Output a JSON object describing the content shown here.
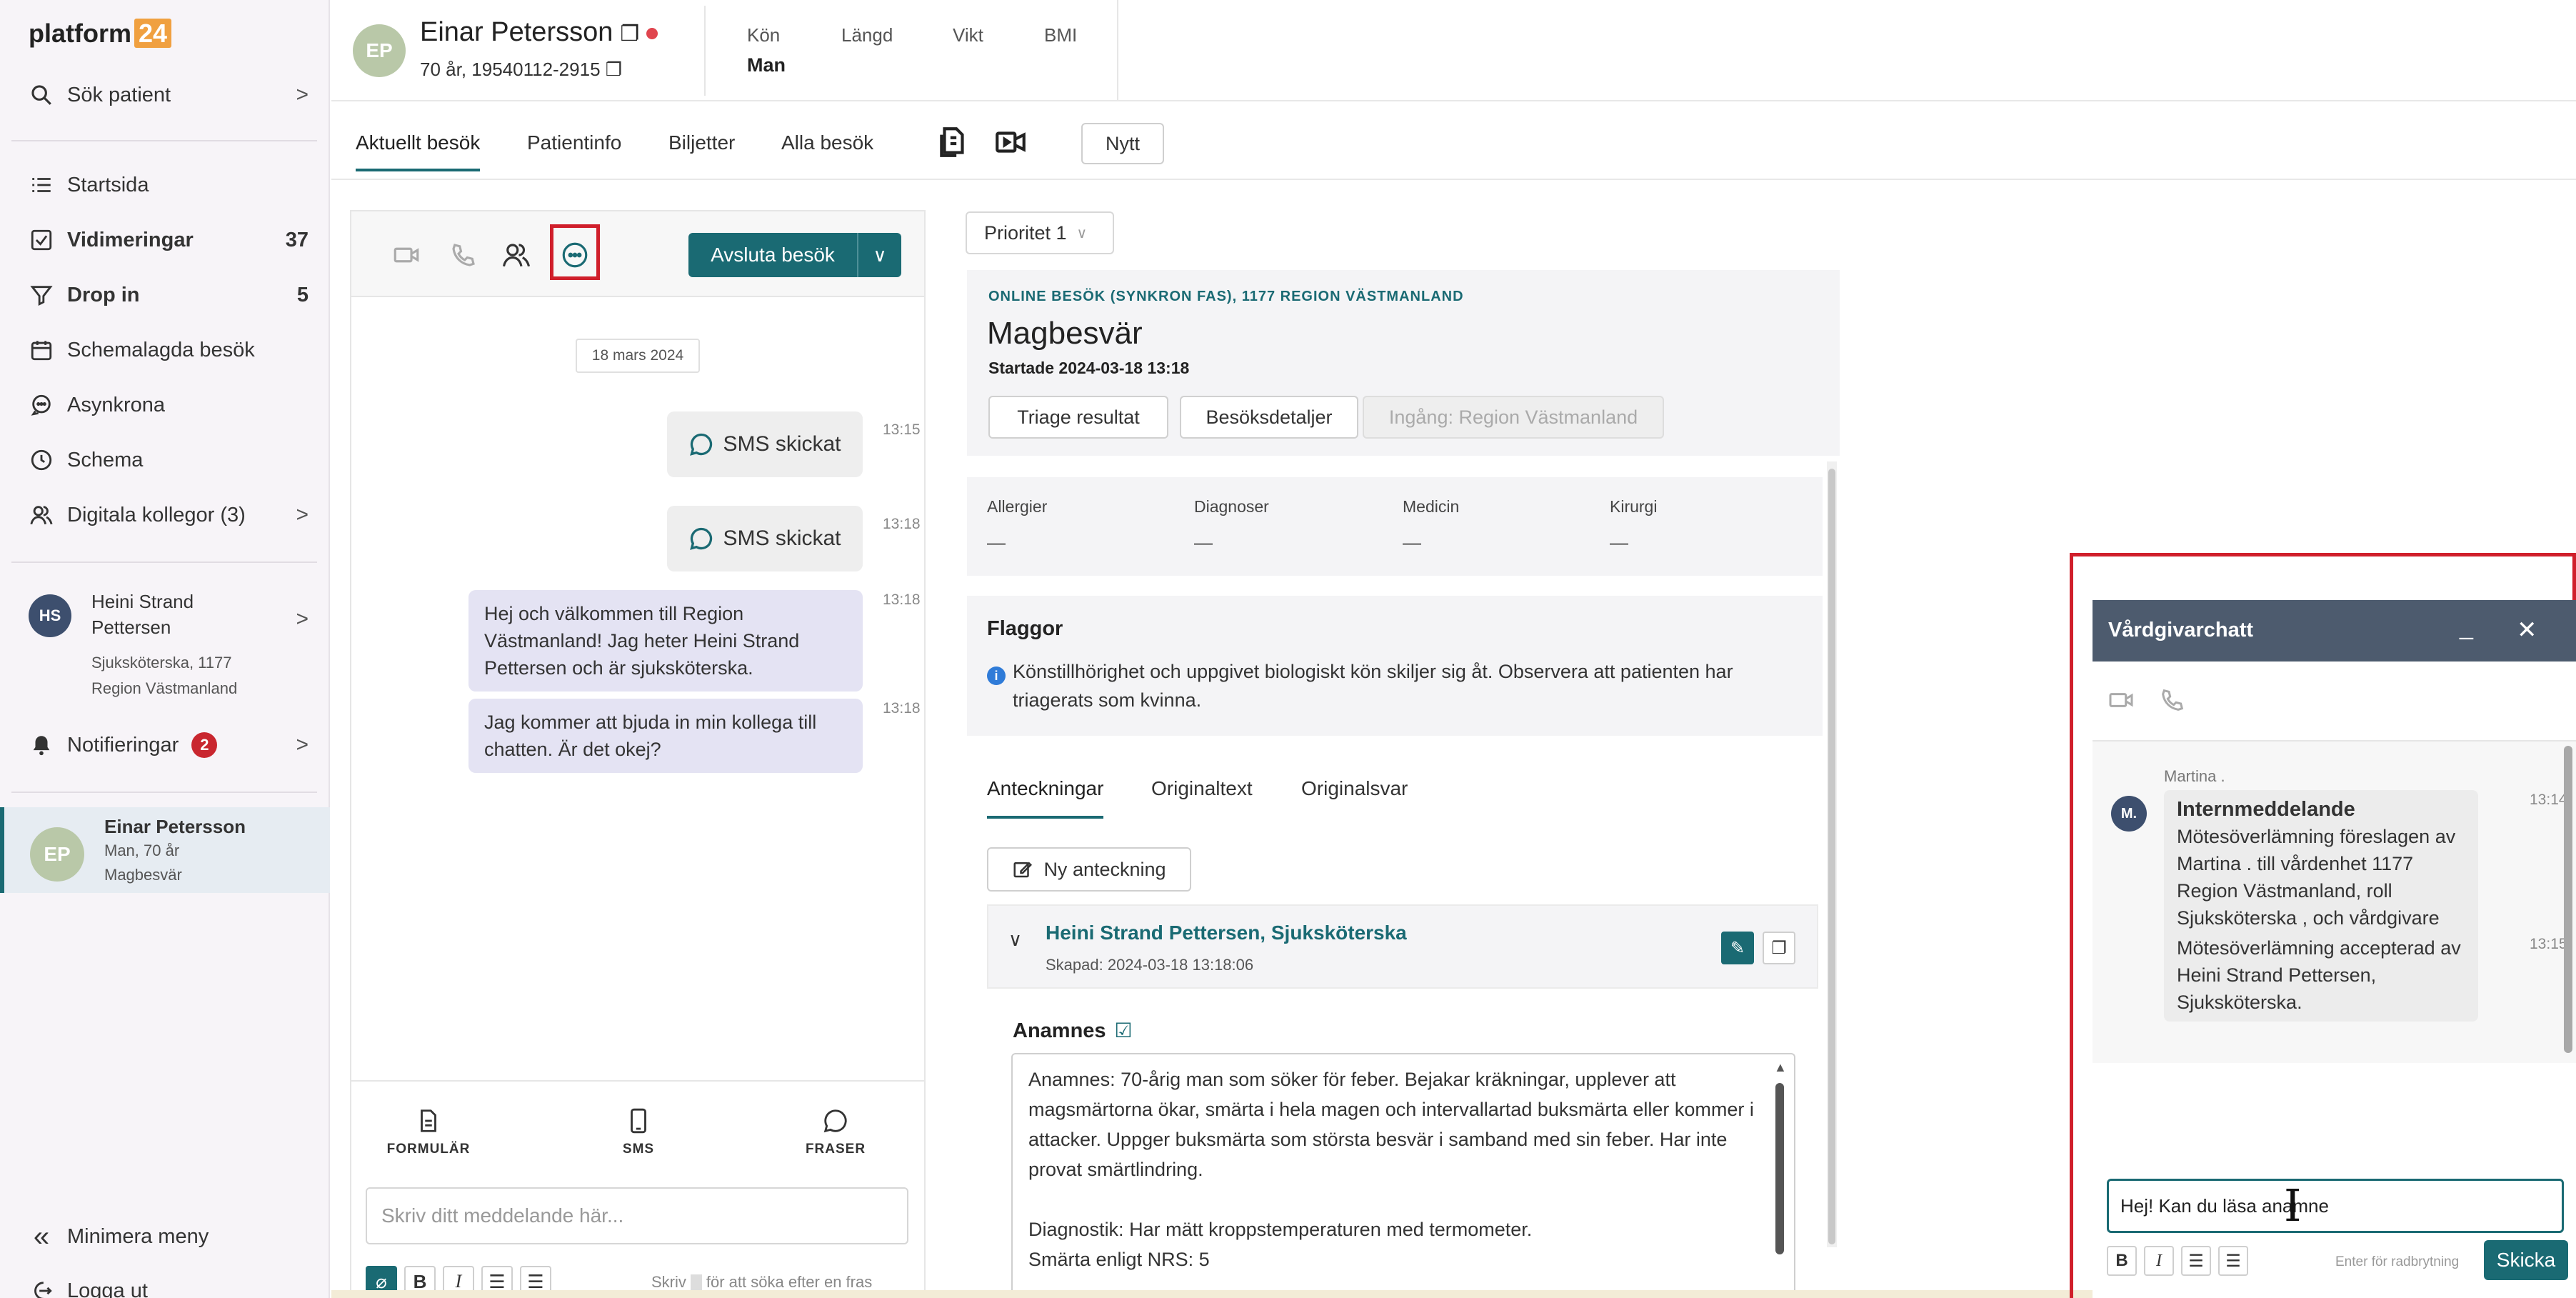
{
  "app": {
    "logo_text": "platform",
    "logo_number": "24"
  },
  "sidebar": {
    "search_label": "Sök patient",
    "items": [
      {
        "label": "Startsida",
        "count": "",
        "icon": "list-icon"
      },
      {
        "label": "Vidimeringar",
        "count": "37",
        "icon": "checkbox-icon"
      },
      {
        "label": "Drop in",
        "count": "5",
        "icon": "funnel-icon"
      },
      {
        "label": "Schemalagda besök",
        "count": "",
        "icon": "calendar-icon"
      },
      {
        "label": "Asynkrona",
        "count": "",
        "icon": "chat-bubbles-icon"
      },
      {
        "label": "Schema",
        "count": "",
        "icon": "clock-icon"
      },
      {
        "label": "Digitala kollegor (3)",
        "count": "",
        "icon": "people-icon"
      }
    ],
    "user": {
      "initials": "HS",
      "name": "Heini Strand Pettersen",
      "role": "Sjuksköterska, 1177 Region Västmanland"
    },
    "notifications": {
      "label": "Notifieringar",
      "count": "2"
    },
    "active_patient": {
      "initials": "EP",
      "name": "Einar Petersson",
      "line2": "Man, 70 år",
      "line3": "Magbesvär"
    },
    "minimize_label": "Minimera meny",
    "logout_label": "Logga ut"
  },
  "header": {
    "initials": "EP",
    "patient_name": "Einar Petersson",
    "patient_sub": "70 år, 19540112-2915",
    "stats": [
      {
        "label": "Kön",
        "value": "Man"
      },
      {
        "label": "Längd",
        "value": ""
      },
      {
        "label": "Vikt",
        "value": ""
      },
      {
        "label": "BMI",
        "value": ""
      }
    ]
  },
  "tabs": {
    "items": [
      "Aktuellt besök",
      "Patientinfo",
      "Biljetter",
      "Alla besök"
    ],
    "active": "Aktuellt besök",
    "new_label": "Nytt"
  },
  "chat": {
    "end_visit_label": "Avsluta besök",
    "date": "18 mars 2024",
    "sms_label": "SMS skickat",
    "messages": [
      {
        "type": "sms",
        "time": "13:15"
      },
      {
        "type": "sms",
        "time": "13:18"
      },
      {
        "type": "text",
        "time": "13:18",
        "text": "Hej och välkommen till Region Västmanland! Jag heter Heini Strand Pettersen och är sjuksköterska."
      },
      {
        "type": "text",
        "time": "13:18",
        "text": "Jag kommer att bjuda in min kollega till chatten. Är det okej?"
      }
    ],
    "bottom_tabs": [
      "FORMULÄR",
      "SMS",
      "FRASER"
    ],
    "input_placeholder": "Skriv ditt meddelande här...",
    "hint_prefix": "Skriv",
    "hint_suffix": "för att söka efter en fras"
  },
  "visit": {
    "priority": "Prioritet 1",
    "kicker": "ONLINE BESÖK (SYNKRON FAS), 1177 REGION VÄSTMANLAND",
    "title": "Magbesvär",
    "started": "Startade 2024-03-18 13:18",
    "buttons": [
      "Triage resultat",
      "Besöksdetaljer",
      "Ingång: Region Västmanland"
    ]
  },
  "medical_info": [
    {
      "label": "Allergier",
      "value": "—"
    },
    {
      "label": "Diagnoser",
      "value": "—"
    },
    {
      "label": "Medicin",
      "value": "—"
    },
    {
      "label": "Kirurgi",
      "value": "—"
    }
  ],
  "flags": {
    "title": "Flaggor",
    "text_line1": "Könstillhörighet och uppgivet biologiskt kön skiljer sig åt. Observera att patienten har",
    "text_line2": "triagerats som kvinna."
  },
  "notes": {
    "tabs": [
      "Anteckningar",
      "Originaltext",
      "Originalsvar"
    ],
    "active": "Anteckningar",
    "new_note_label": "Ny anteckning",
    "author": "Heini Strand Pettersen, Sjuksköterska",
    "created": "Skapad: 2024-03-18 13:18:06",
    "anamnes_label": "Anamnes",
    "anamnes_text": "Anamnes: 70-årig man som söker för feber. Bejakar kräkningar, upplever att magsmärtorna ökar, smärta i hela magen och intervallartad buksmärta eller kommer i attacker. Uppger buksmärta som största besvär i samband med sin feber. Har inte provat smärtlindring.",
    "diagnostik_text": "Diagnostik: Har mätt kroppstemperaturen med termometer.",
    "smarta_text": "Smärta enligt NRS: 5"
  },
  "provider_chat": {
    "title": "Vårdgivarchatt",
    "sender": "Martina .",
    "sender_initials": "M.",
    "messages": [
      {
        "time": "13:14",
        "heading": "Internmeddelande",
        "text": "Mötesöverlämning föreslagen av Martina . till vårdenhet 1177 Region Västmanland, roll Sjuksköterska , och vårdgivare Heini Strand Pettersen. Meddelande: Kan du ta denna patient, jag behöver vabba."
      },
      {
        "time": "13:15",
        "heading": "",
        "text": "Mötesöverlämning accepterad av Heini Strand Pettersen, Sjuksköterska."
      }
    ],
    "input_value": "Hej! Kan du läsa anamne",
    "hint": "Enter för radbrytning",
    "send_label": "Skicka"
  },
  "colors": {
    "brand_teal": "#1a6a73",
    "highlight_red": "#d01f2b",
    "widget_header": "#4d5b6e",
    "bubble_lavender": "#e4e3f3"
  }
}
